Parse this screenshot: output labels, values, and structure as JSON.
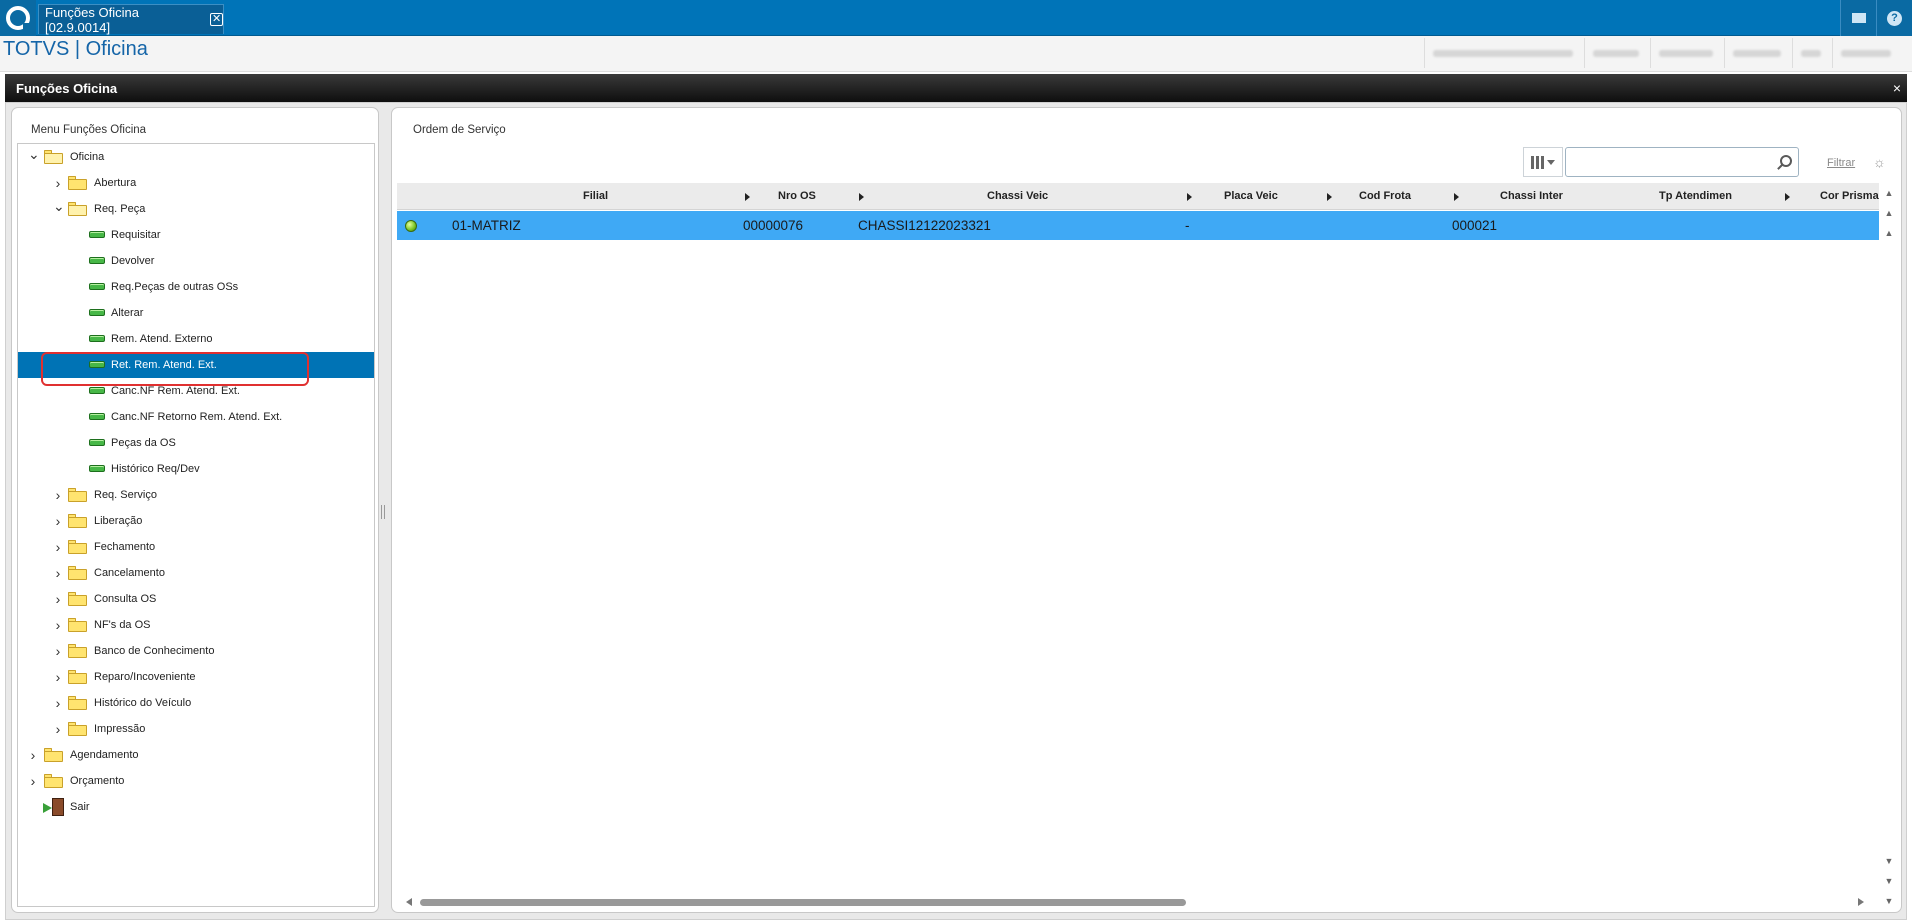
{
  "topbar": {
    "tab_label": "Funções Oficina [02.9.0014]",
    "tab_close": "✕",
    "help_glyph": "?",
    "colors": {
      "bar": "#0074b8",
      "accent": "#1565a8"
    }
  },
  "header": {
    "app_title": "TOTVS | Oficina",
    "info_cells": [
      "",
      "",
      "",
      "",
      "",
      ""
    ]
  },
  "window": {
    "title": "Funções Oficina",
    "close_glyph": "×"
  },
  "menu": {
    "title": "Menu Funções Oficina",
    "items": [
      {
        "label": "Oficina",
        "level": 0,
        "icon": "folder-open-icon",
        "expanded": true
      },
      {
        "label": "Abertura",
        "level": 1,
        "icon": "folder-icon",
        "expanded": false
      },
      {
        "label": "Req. Peça",
        "level": 1,
        "icon": "folder-open-icon",
        "expanded": true
      },
      {
        "label": "Requisitar",
        "level": 2,
        "icon": "routine-icon"
      },
      {
        "label": "Devolver",
        "level": 2,
        "icon": "routine-icon"
      },
      {
        "label": "Req.Peças de outras OSs",
        "level": 2,
        "icon": "routine-icon"
      },
      {
        "label": "Alterar",
        "level": 2,
        "icon": "routine-icon"
      },
      {
        "label": "Rem. Atend. Externo",
        "level": 2,
        "icon": "routine-icon"
      },
      {
        "label": "Ret. Rem. Atend. Ext.",
        "level": 2,
        "icon": "routine-icon",
        "selected": true
      },
      {
        "label": "Canc.NF Rem. Atend. Ext.",
        "level": 2,
        "icon": "routine-icon"
      },
      {
        "label": "Canc.NF Retorno Rem. Atend. Ext.",
        "level": 2,
        "icon": "routine-icon"
      },
      {
        "label": "Peças da OS",
        "level": 2,
        "icon": "routine-icon"
      },
      {
        "label": "Histórico Req/Dev",
        "level": 2,
        "icon": "routine-icon"
      },
      {
        "label": "Req. Serviço",
        "level": 1,
        "icon": "folder-icon",
        "expanded": false
      },
      {
        "label": "Liberação",
        "level": 1,
        "icon": "folder-icon",
        "expanded": false
      },
      {
        "label": "Fechamento",
        "level": 1,
        "icon": "folder-icon",
        "expanded": false
      },
      {
        "label": "Cancelamento",
        "level": 1,
        "icon": "folder-icon",
        "expanded": false
      },
      {
        "label": "Consulta OS",
        "level": 1,
        "icon": "folder-icon",
        "expanded": false
      },
      {
        "label": "NF's da OS",
        "level": 1,
        "icon": "folder-icon",
        "expanded": false
      },
      {
        "label": "Banco de Conhecimento",
        "level": 1,
        "icon": "folder-icon",
        "expanded": false
      },
      {
        "label": "Reparo/Incoveniente",
        "level": 1,
        "icon": "folder-icon",
        "expanded": false
      },
      {
        "label": "Histórico do Veículo",
        "level": 1,
        "icon": "folder-icon",
        "expanded": false
      },
      {
        "label": "Impressão",
        "level": 1,
        "icon": "folder-icon",
        "expanded": false
      },
      {
        "label": "Agendamento",
        "level": 0,
        "icon": "folder-icon",
        "expanded": false
      },
      {
        "label": "Orçamento",
        "level": 0,
        "icon": "folder-icon",
        "expanded": false
      },
      {
        "label": "Sair",
        "level": 0,
        "icon": "exit-icon"
      }
    ]
  },
  "os_panel": {
    "title": "Ordem de Serviço",
    "search_placeholder": "",
    "filter_label": "Filtrar",
    "columns": [
      "Filial",
      "Nro OS",
      "Chassi Veic",
      "Placa Veic",
      "Cod Frota",
      "Chassi Inter",
      "Tp Atendimen",
      "Cor Prisma"
    ],
    "rows": [
      {
        "status": "green",
        "cells": [
          "01-MATRIZ",
          "00000076",
          "CHASSI12122023321",
          "-",
          "",
          "000021",
          "",
          ""
        ]
      }
    ]
  }
}
